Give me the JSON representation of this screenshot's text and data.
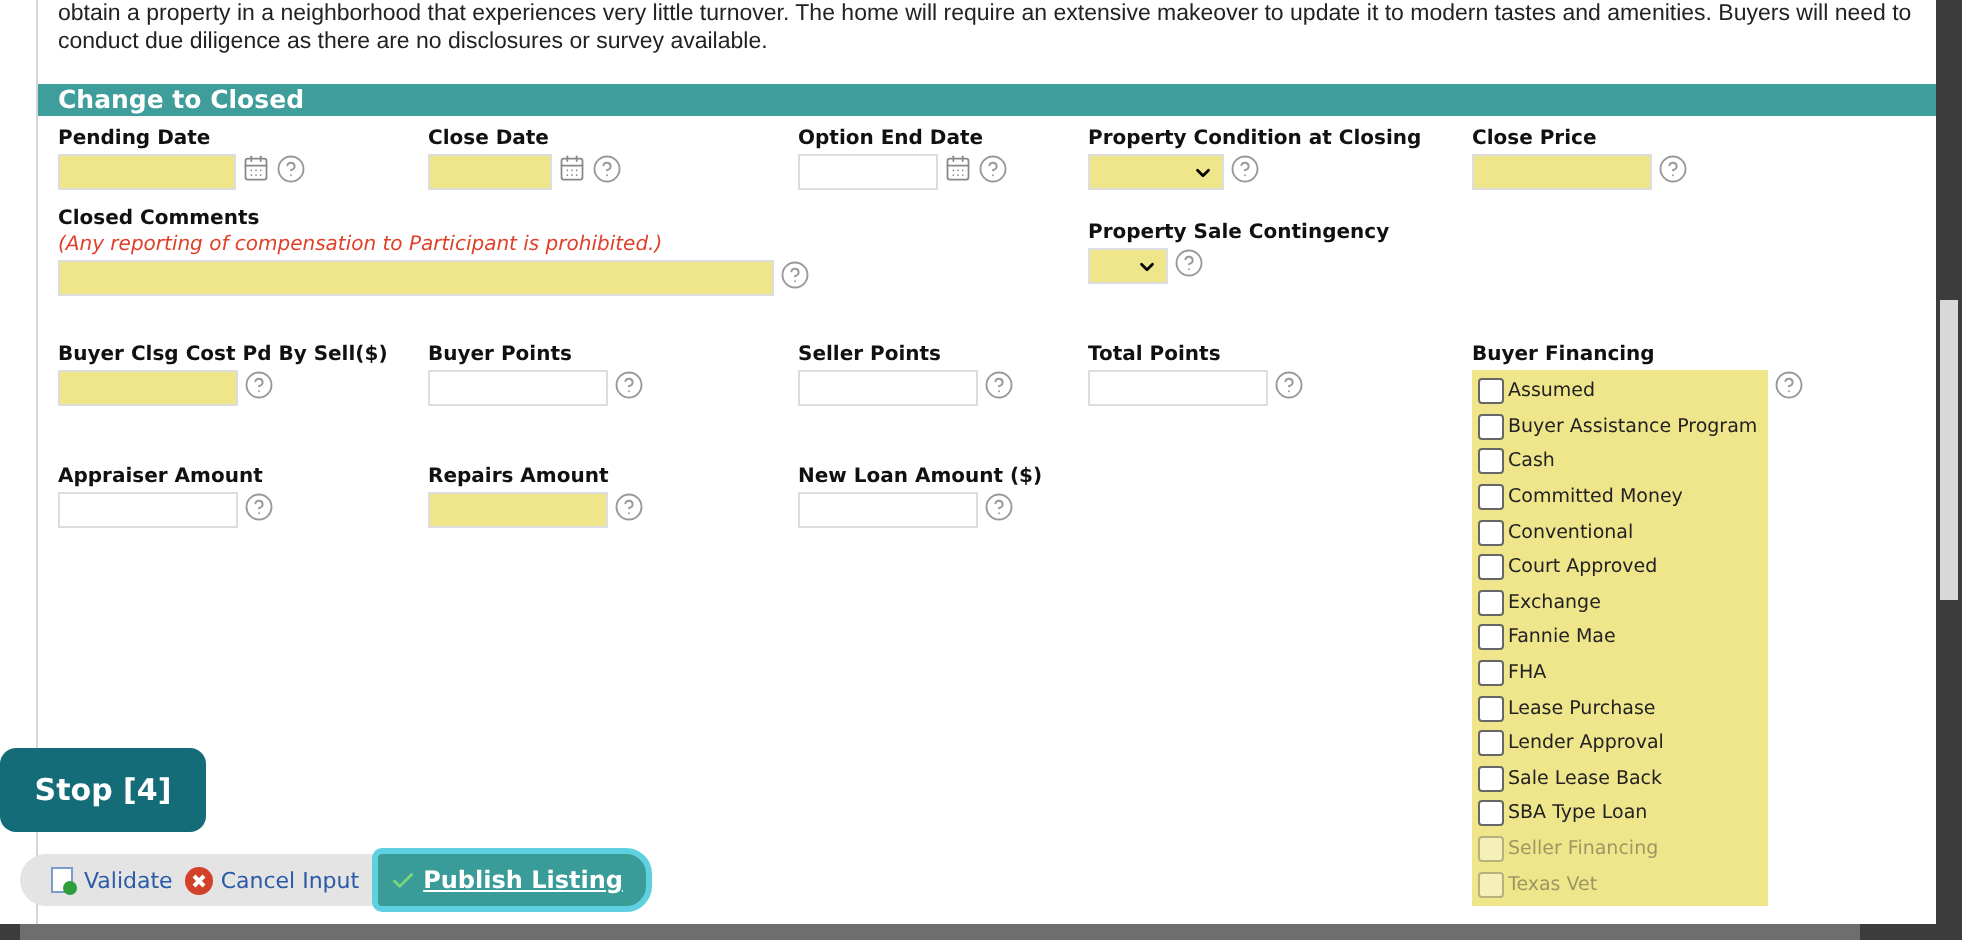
{
  "description": [
    "obtain a property in a neighborhood that experiences very little turnover. The home will require an extensive makeover to update it to modern tastes and amenities. Buyers will need to",
    "conduct due diligence as there are no disclosures or survey available."
  ],
  "section": {
    "title": "Change to Closed"
  },
  "rows": [
    {
      "cells": [
        {
          "kind": "date",
          "label": "Pending Date",
          "required": true
        },
        {
          "kind": "date",
          "label": "Close Date",
          "required": true
        },
        {
          "kind": "date",
          "label": "Option End Date",
          "required": false
        },
        {
          "kind": "select",
          "label": "Property Condition at Closing",
          "required": true
        },
        {
          "kind": "text",
          "label": "Close Price",
          "required": true
        }
      ]
    },
    {
      "cells": [
        {
          "kind": "comment",
          "label": "Closed Comments",
          "note": "(Any reporting of compensation to Participant is prohibited.)",
          "required": true
        },
        {
          "kind": "select_small",
          "label": "Property Sale Contingency",
          "required": true
        }
      ]
    },
    {
      "cells": [
        {
          "kind": "text",
          "label": "Buyer Clsg Cost Pd By Sell($)",
          "required": true
        },
        {
          "kind": "text",
          "label": "Buyer Points",
          "required": false
        },
        {
          "kind": "text",
          "label": "Seller Points",
          "required": false
        },
        {
          "kind": "text",
          "label": "Total Points",
          "required": false
        },
        {
          "kind": "checklist",
          "label": "Buyer Financing",
          "required": true,
          "options": [
            {
              "label": "Assumed",
              "checked": false,
              "dimmed": false
            },
            {
              "label": "Buyer Assistance Program",
              "checked": false,
              "dimmed": false
            },
            {
              "label": "Cash",
              "checked": false,
              "dimmed": false
            },
            {
              "label": "Committed Money",
              "checked": false,
              "dimmed": false
            },
            {
              "label": "Conventional",
              "checked": false,
              "dimmed": false
            },
            {
              "label": "Court Approved",
              "checked": false,
              "dimmed": false
            },
            {
              "label": "Exchange",
              "checked": false,
              "dimmed": false
            },
            {
              "label": "Fannie Mae",
              "checked": false,
              "dimmed": false
            },
            {
              "label": "FHA",
              "checked": false,
              "dimmed": false
            },
            {
              "label": "Lease Purchase",
              "checked": false,
              "dimmed": false
            },
            {
              "label": "Lender Approval",
              "checked": false,
              "dimmed": false
            },
            {
              "label": "Sale Lease Back",
              "checked": false,
              "dimmed": false
            },
            {
              "label": "SBA Type Loan",
              "checked": false,
              "dimmed": false
            },
            {
              "label": "Seller Financing",
              "checked": false,
              "dimmed": true
            },
            {
              "label": "Texas Vet",
              "checked": false,
              "dimmed": true
            }
          ]
        }
      ]
    },
    {
      "cells": [
        {
          "kind": "text",
          "label": "Appraiser Amount",
          "required": false
        },
        {
          "kind": "text",
          "label": "Repairs Amount",
          "required": true
        },
        {
          "kind": "text",
          "label": "New Loan Amount ($)",
          "required": false
        }
      ]
    }
  ],
  "stop_button": "Stop [4]",
  "toolbar": [
    {
      "kind": "validate",
      "label": "Validate"
    },
    {
      "kind": "cancel",
      "label": "Cancel Input"
    },
    {
      "kind": "publish",
      "label": "Publish Listing"
    }
  ]
}
